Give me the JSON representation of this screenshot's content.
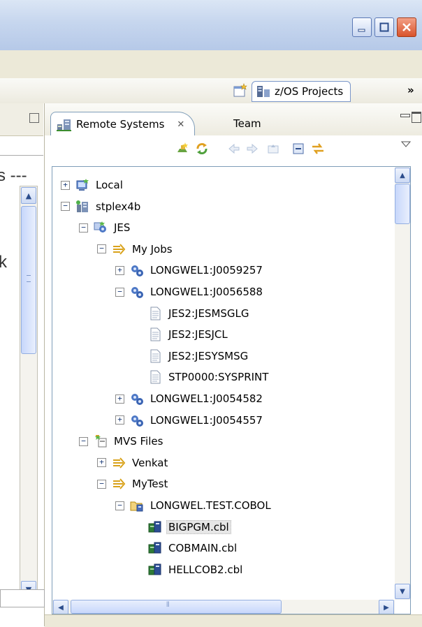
{
  "window": {
    "buttons": [
      {
        "name": "minimize-button"
      },
      {
        "name": "maximize-button"
      },
      {
        "name": "close-button"
      }
    ]
  },
  "perspective": {
    "label": "z/OS Projects",
    "more": "»"
  },
  "left_snippets": [
    {
      "text": "s ---",
      "top": 0
    },
    {
      "text": "k",
      "top": 0
    }
  ],
  "view": {
    "tab_label": "Remote Systems",
    "tab_close": "✕",
    "other_tab": "Team"
  },
  "tree": [
    {
      "label": "Local",
      "depth": 0,
      "expander": "+",
      "icon": "local-host-icon"
    },
    {
      "label": "stplex4b",
      "depth": 0,
      "expander": "−",
      "icon": "remote-host-icon"
    },
    {
      "label": "JES",
      "depth": 1,
      "expander": "−",
      "icon": "jes-subsystem-icon"
    },
    {
      "label": "My Jobs",
      "depth": 2,
      "expander": "−",
      "icon": "job-filter-icon"
    },
    {
      "label": "LONGWEL1:J0059257",
      "depth": 3,
      "expander": "+",
      "icon": "job-gears-icon"
    },
    {
      "label": "LONGWEL1:J0056588",
      "depth": 3,
      "expander": "−",
      "icon": "job-gears-icon"
    },
    {
      "label": "JES2:JESMSGLG",
      "depth": 4,
      "expander": "",
      "icon": "spool-file-icon"
    },
    {
      "label": "JES2:JESJCL",
      "depth": 4,
      "expander": "",
      "icon": "spool-file-icon"
    },
    {
      "label": "JES2:JESYSMSG",
      "depth": 4,
      "expander": "",
      "icon": "spool-file-icon"
    },
    {
      "label": "STP0000:SYSPRINT",
      "depth": 4,
      "expander": "",
      "icon": "spool-file-icon"
    },
    {
      "label": "LONGWEL1:J0054582",
      "depth": 3,
      "expander": "+",
      "icon": "job-gears-icon"
    },
    {
      "label": "LONGWEL1:J0054557",
      "depth": 3,
      "expander": "+",
      "icon": "job-gears-icon"
    },
    {
      "label": "MVS Files",
      "depth": 1,
      "expander": "−",
      "icon": "mvs-files-icon"
    },
    {
      "label": "Venkat",
      "depth": 2,
      "expander": "+",
      "icon": "dataset-filter-icon"
    },
    {
      "label": "MyTest",
      "depth": 2,
      "expander": "−",
      "icon": "dataset-filter-icon"
    },
    {
      "label": "LONGWEL.TEST.COBOL",
      "depth": 3,
      "expander": "−",
      "icon": "pds-folder-icon"
    },
    {
      "label": "BIGPGM.cbl",
      "depth": 4,
      "expander": "",
      "icon": "cobol-member-icon",
      "selected": true
    },
    {
      "label": "COBMAIN.cbl",
      "depth": 4,
      "expander": "",
      "icon": "cobol-member-icon"
    },
    {
      "label": "HELLCOB2.cbl",
      "depth": 4,
      "expander": "",
      "icon": "cobol-member-icon"
    }
  ],
  "colors": {
    "title_gradient_top": "#dbe6f5",
    "close_red": "#d9532b",
    "selection": "#e6e6e6",
    "border_blue": "#7f9db9"
  }
}
